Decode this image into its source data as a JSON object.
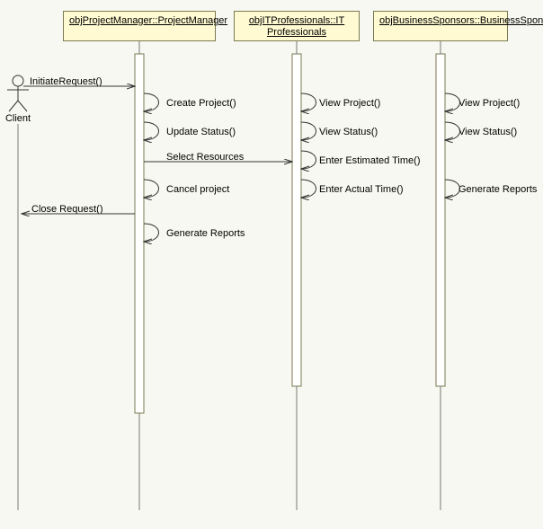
{
  "participants": {
    "client": {
      "label": "Client"
    },
    "pm": {
      "label": "objProjectManager::ProjectManager"
    },
    "itp": {
      "label": "objITProfessionals::IT Professionals"
    },
    "bs": {
      "label": "objBusinessSponsors::BusinessSponsors"
    }
  },
  "messages": {
    "initiate": "InitiateRequest()",
    "createProject": "Create Project()",
    "updateStatus": "Update Status()",
    "selectResources": "Select Resources",
    "cancelProject": "Cancel project",
    "closeRequest": "Close Request()",
    "pmReports": "Generate Reports",
    "viewProjectIT": "View Project()",
    "viewStatusIT": "View Status()",
    "estTime": "Enter Estimated Time()",
    "actTime": "Enter Actual Time()",
    "viewProjectBS": "View Project()",
    "viewStatusBS": "View Status()",
    "bsReports": "Generate Reports"
  }
}
